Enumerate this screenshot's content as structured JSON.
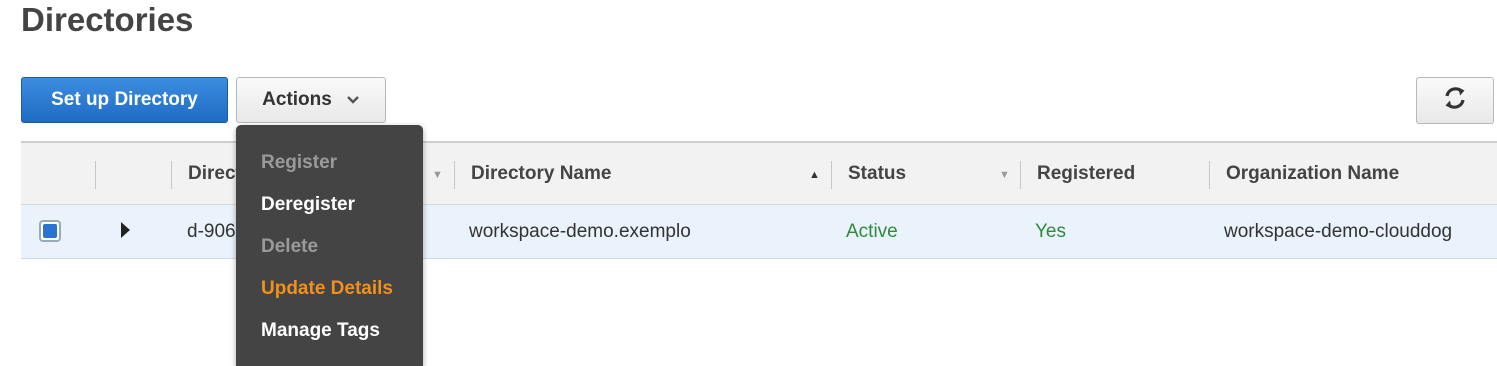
{
  "page_title": "Directories",
  "toolbar": {
    "setup_label": "Set up Directory",
    "actions_label": "Actions"
  },
  "table": {
    "columns": [
      "Directory ID",
      "Directory Name",
      "Status",
      "Registered",
      "Organization Name"
    ],
    "sorted_column": "Directory Name",
    "rows": [
      {
        "selected": true,
        "directory_id": "d-906",
        "directory_name": "workspace-demo.exemplo",
        "status": "Active",
        "registered": "Yes",
        "organization_name": "workspace-demo-clouddog"
      }
    ]
  },
  "actions_menu": {
    "items": [
      {
        "label": "Register",
        "state": "disabled"
      },
      {
        "label": "Deregister",
        "state": "enabled"
      },
      {
        "label": "Delete",
        "state": "disabled"
      },
      {
        "label": "Update Details",
        "state": "hovered"
      },
      {
        "label": "Manage Tags",
        "state": "enabled"
      }
    ]
  },
  "colors": {
    "primary_button": "#1f6bc4",
    "status_active": "#2e8b3a",
    "menu_bg": "#444444",
    "menu_hover": "#f0901e",
    "menu_disabled": "#9a9a9a",
    "row_selected_bg": "#eaf2fb"
  },
  "icons": {
    "refresh": "refresh-icon",
    "dropdown": "chevron-down-icon",
    "expand": "caret-right-icon"
  }
}
